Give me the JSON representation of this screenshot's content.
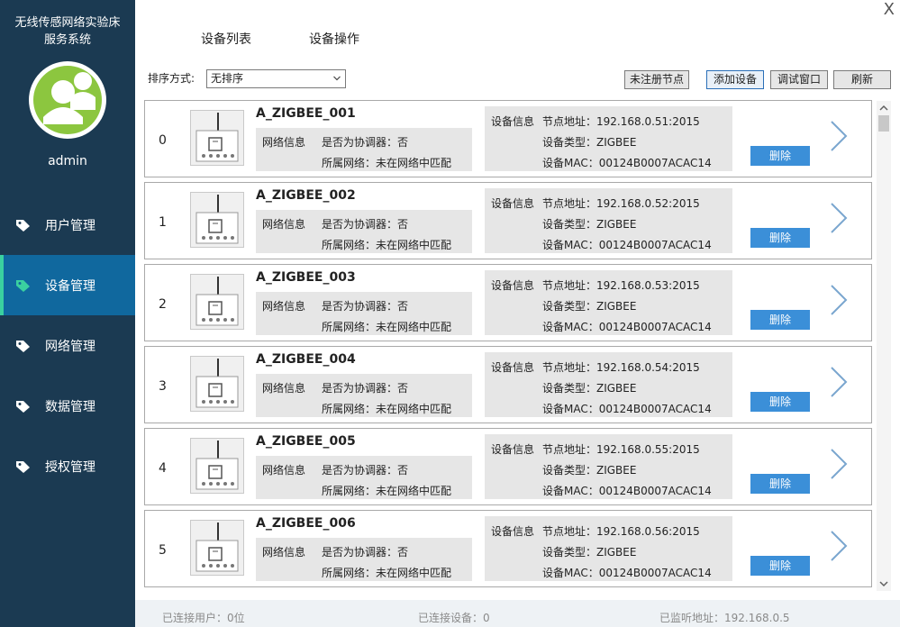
{
  "app": {
    "title_line1": "无线传感网络实验床",
    "title_line2": "服务系统",
    "username": "admin",
    "close_glyph": "X"
  },
  "nav": {
    "items": [
      {
        "label": "用户管理",
        "icon": "tag-icon",
        "active": false
      },
      {
        "label": "设备管理",
        "icon": "tag-icon",
        "active": true
      },
      {
        "label": "网络管理",
        "icon": "tag-icon",
        "active": false
      },
      {
        "label": "数据管理",
        "icon": "tag-icon",
        "active": false
      },
      {
        "label": "授权管理",
        "icon": "tag-icon",
        "active": false
      }
    ]
  },
  "tabs": [
    {
      "label": "设备列表"
    },
    {
      "label": "设备操作"
    }
  ],
  "toolbar": {
    "sort_label": "排序方式:",
    "sort_value": "无排序",
    "unregistered_label": "未注册节点",
    "add_label": "添加设备",
    "debug_label": "调试窗口",
    "refresh_label": "刷新"
  },
  "devices": [
    {
      "index": "0",
      "name": "A_ZIGBEE_001",
      "net_title": "网络信息",
      "coordinator": "是否为协调器：否",
      "network": "所属网络：未在网络中匹配",
      "info_title": "设备信息",
      "address": "节点地址：192.168.0.51:2015",
      "type": "设备类型：ZIGBEE",
      "mac": "设备MAC：00124B0007ACAC14",
      "delete_label": "删除"
    },
    {
      "index": "1",
      "name": "A_ZIGBEE_002",
      "net_title": "网络信息",
      "coordinator": "是否为协调器：否",
      "network": "所属网络：未在网络中匹配",
      "info_title": "设备信息",
      "address": "节点地址：192.168.0.52:2015",
      "type": "设备类型：ZIGBEE",
      "mac": "设备MAC：00124B0007ACAC14",
      "delete_label": "删除"
    },
    {
      "index": "2",
      "name": "A_ZIGBEE_003",
      "net_title": "网络信息",
      "coordinator": "是否为协调器：否",
      "network": "所属网络：未在网络中匹配",
      "info_title": "设备信息",
      "address": "节点地址：192.168.0.53:2015",
      "type": "设备类型：ZIGBEE",
      "mac": "设备MAC：00124B0007ACAC14",
      "delete_label": "删除"
    },
    {
      "index": "3",
      "name": "A_ZIGBEE_004",
      "net_title": "网络信息",
      "coordinator": "是否为协调器：否",
      "network": "所属网络：未在网络中匹配",
      "info_title": "设备信息",
      "address": "节点地址：192.168.0.54:2015",
      "type": "设备类型：ZIGBEE",
      "mac": "设备MAC：00124B0007ACAC14",
      "delete_label": "删除"
    },
    {
      "index": "4",
      "name": "A_ZIGBEE_005",
      "net_title": "网络信息",
      "coordinator": "是否为协调器：否",
      "network": "所属网络：未在网络中匹配",
      "info_title": "设备信息",
      "address": "节点地址：192.168.0.55:2015",
      "type": "设备类型：ZIGBEE",
      "mac": "设备MAC：00124B0007ACAC14",
      "delete_label": "删除"
    },
    {
      "index": "5",
      "name": "A_ZIGBEE_006",
      "net_title": "网络信息",
      "coordinator": "是否为协调器：否",
      "network": "所属网络：未在网络中匹配",
      "info_title": "设备信息",
      "address": "节点地址：192.168.0.56:2015",
      "type": "设备类型：ZIGBEE",
      "mac": "设备MAC：00124B0007ACAC14",
      "delete_label": "删除"
    }
  ],
  "status": {
    "users": "已连接用户：0位",
    "devices": "已连接设备：0",
    "listen": "已监听地址：192.168.0.5"
  },
  "colors": {
    "sidebar_bg": "#1b3a52",
    "nav_active_bg": "#10689e",
    "avatar_green": "#8cc63f",
    "delete_button": "#3b8fd8"
  }
}
